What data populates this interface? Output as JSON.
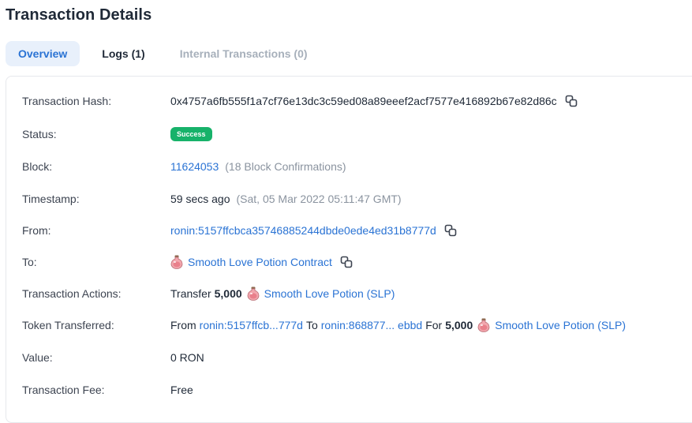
{
  "page": {
    "title": "Transaction Details"
  },
  "tabs": [
    {
      "label": "Overview"
    },
    {
      "label": "Logs (1)"
    },
    {
      "label": "Internal Transactions (0)"
    }
  ],
  "details": {
    "hash": {
      "label": "Transaction Hash:",
      "value": "0x4757a6fb555f1a7cf76e13dc3c59ed08a89eeef2acf7577e416892b67e82d86c",
      "icon": "copy-icon"
    },
    "status": {
      "label": "Status:",
      "value": "Success",
      "color": "#17b26a"
    },
    "block": {
      "label": "Block:",
      "number": "11624053",
      "confirmations": "(18 Block Confirmations)"
    },
    "timestamp": {
      "label": "Timestamp:",
      "relative": "59 secs ago",
      "absolute": "(Sat, 05 Mar 2022 05:11:47 GMT)"
    },
    "from": {
      "label": "From:",
      "address": "ronin:5157ffcbca35746885244dbde0ede4ed31b8777d",
      "icon": "copy-icon"
    },
    "to": {
      "label": "To:",
      "name": "Smooth Love Potion Contract",
      "icon": "slp-token-icon"
    },
    "actions": {
      "label": "Transaction Actions:",
      "verb": "Transfer",
      "amount": "5,000",
      "token": "Smooth Love Potion (SLP)"
    },
    "token_transferred": {
      "label": "Token Transferred:",
      "from_word": "From",
      "from_address": "ronin:5157ffcb...777d",
      "to_word": "To",
      "to_address": "ronin:868877... ebbd",
      "for_word": "For",
      "amount": "5,000",
      "token": "Smooth Love Potion (SLP)"
    },
    "value": {
      "label": "Value:",
      "value": "0 RON"
    },
    "fee": {
      "label": "Transaction Fee:",
      "value": "Free"
    }
  },
  "colors": {
    "accent": "#2a73d4",
    "success": "#17b26a",
    "muted": "#8a939f"
  }
}
